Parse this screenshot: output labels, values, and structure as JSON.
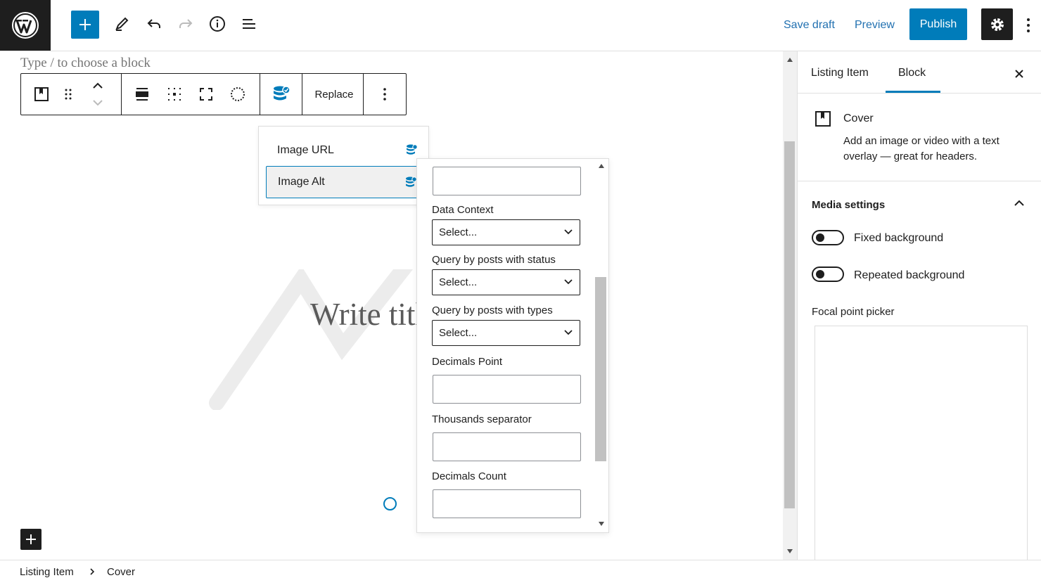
{
  "header": {
    "save_draft": "Save draft",
    "preview": "Preview",
    "publish": "Publish"
  },
  "canvas": {
    "type_hint": "Type / to choose a block",
    "write_title": "Write title…"
  },
  "toolbar": {
    "replace": "Replace"
  },
  "dynamic_menu": {
    "items": [
      {
        "label": "Image URL"
      },
      {
        "label": "Image Alt"
      }
    ]
  },
  "popover": {
    "data_context_label": "Data Context",
    "data_context_value": "Select...",
    "status_label": "Query by posts with status",
    "status_value": "Select...",
    "types_label": "Query by posts with types",
    "types_value": "Select...",
    "decimals_point_label": "Decimals Point",
    "thousands_label": "Thousands separator",
    "decimals_count_label": "Decimals Count"
  },
  "sidebar": {
    "tabs": [
      {
        "label": "Listing Item"
      },
      {
        "label": "Block"
      }
    ],
    "block_name": "Cover",
    "block_desc": "Add an image or video with a text overlay — great for headers.",
    "media_settings": "Media settings",
    "fixed_bg": "Fixed background",
    "repeated_bg": "Repeated background",
    "focal_picker": "Focal point picker"
  },
  "footer": {
    "crumbs": [
      "Listing Item",
      "Cover"
    ]
  },
  "colors": {
    "accent": "#007cba",
    "dark": "#1e1e1e"
  }
}
